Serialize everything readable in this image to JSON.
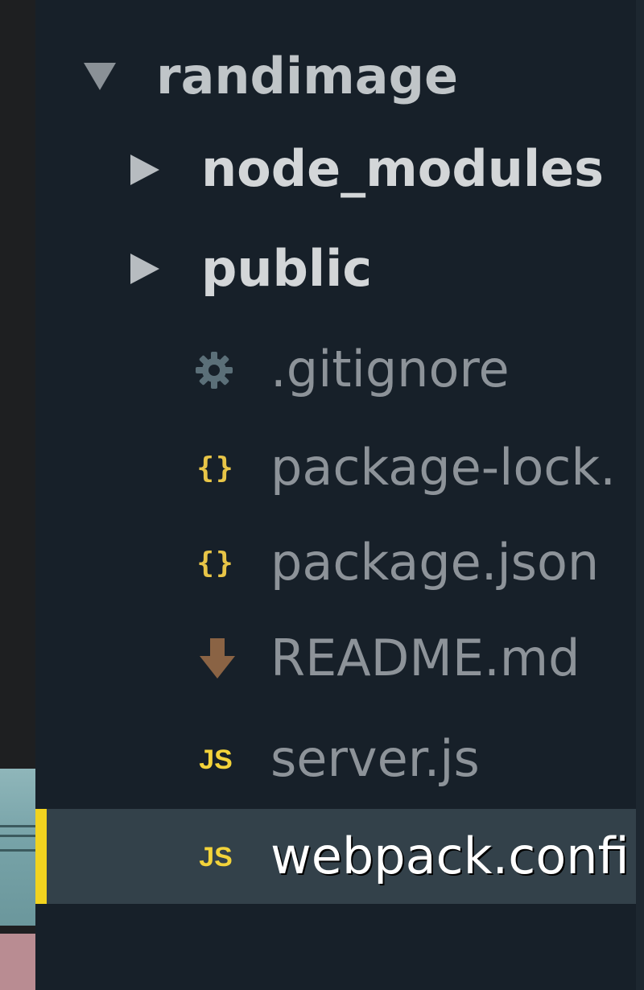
{
  "tree": {
    "root": {
      "label": "randimage",
      "expanded": true,
      "icon": "triangle-down-icon"
    },
    "folders": [
      {
        "label": "node_modules",
        "expanded": false,
        "icon": "triangle-right-icon"
      },
      {
        "label": "public",
        "expanded": false,
        "icon": "triangle-right-icon"
      }
    ],
    "files": [
      {
        "label": ".gitignore",
        "icon": "gear-icon",
        "icon_color": "#5b6f78"
      },
      {
        "label": "package-lock.",
        "icon": "json-braces-icon",
        "icon_text": "{}",
        "icon_color": "#e8c547"
      },
      {
        "label": "package.json",
        "icon": "json-braces-icon",
        "icon_text": "{}",
        "icon_color": "#e8c547"
      },
      {
        "label": "README.md",
        "icon": "markdown-down-arrow-icon",
        "icon_color": "#8a6344"
      },
      {
        "label": "server.js",
        "icon": "javascript-icon",
        "icon_text": "JS",
        "icon_color": "#f3d33a"
      },
      {
        "label": "webpack.confi",
        "icon": "javascript-icon",
        "icon_text": "JS",
        "icon_color": "#f3d33a",
        "selected": true
      }
    ]
  },
  "colors": {
    "background": "#172029",
    "selected_background": "#33414a",
    "selected_marker": "#f2d31f",
    "folder_text": "#d3d6d8",
    "file_text": "#8d9399"
  }
}
